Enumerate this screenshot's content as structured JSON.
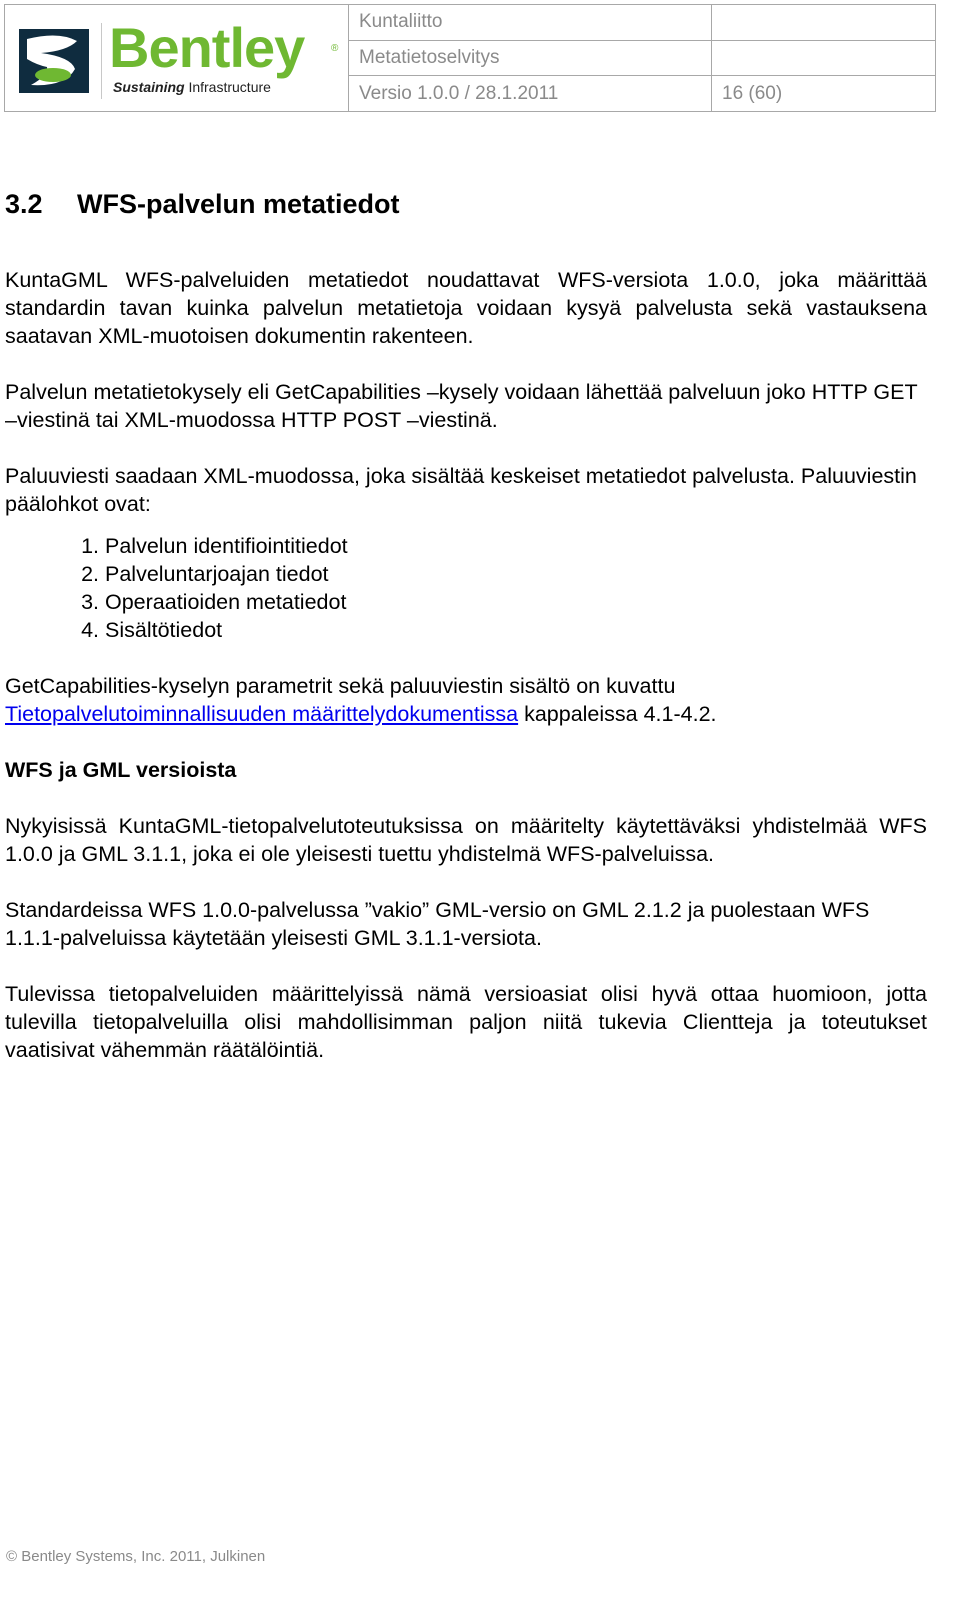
{
  "header": {
    "logo": {
      "brand": "Bentley",
      "tagline_bold": "Sustaining",
      "tagline_rest": "Infrastructure",
      "registered": "®",
      "accent_color": "#6fb832"
    },
    "rows": [
      {
        "main": "Kuntaliitto",
        "side": ""
      },
      {
        "main": "Metatietoselvitys",
        "side": ""
      },
      {
        "main": "Versio 1.0.0 / 28.1.2011",
        "side": "16 (60)"
      }
    ]
  },
  "section": {
    "number": "3.2",
    "title": "WFS-palvelun metatiedot"
  },
  "paragraphs": {
    "p1": "KuntaGML WFS-palveluiden metatiedot noudattavat WFS-versiota 1.0.0, joka määrittää standardin tavan kuinka palvelun metatietoja voidaan kysyä palvelusta sekä vastauksena saatavan XML-muotoisen dokumentin rakenteen.",
    "p2": "Palvelun metatietokysely eli GetCapabilities –kysely voidaan lähettää palveluun joko HTTP GET –viestinä tai XML-muodossa HTTP POST –viestinä.",
    "p3": "Paluuviesti saadaan XML-muodossa, joka sisältää keskeiset metatiedot palvelusta. Paluuviestin päälohkot ovat:",
    "list": [
      "Palvelun identifiointitiedot",
      "Palveluntarjoajan tiedot",
      "Operaatioiden metatiedot",
      "Sisältötiedot"
    ],
    "p4_start": "GetCapabilities-kyselyn parametrit sekä paluuviestin sisältö on kuvattu ",
    "p4_link": "Tietopalvelutoiminnallisuuden määrittelydokumentissa",
    "p4_end": " kappaleissa 4.1-4.2.",
    "subheading": "WFS ja GML versioista",
    "p5": "Nykyisissä KuntaGML-tietopalvelutoteutuksissa on määritelty käytettäväksi yhdistelmää WFS 1.0.0 ja GML 3.1.1, joka ei ole yleisesti tuettu yhdistelmä WFS-palveluissa.",
    "p6": "Standardeissa WFS 1.0.0-palvelussa ”vakio” GML-versio on GML 2.1.2 ja puolestaan WFS 1.1.1-palveluissa käytetään yleisesti GML 3.1.1-versiota.",
    "p7": "Tulevissa tietopalveluiden määrittelyissä nämä versioasiat olisi hyvä ottaa huomioon, jotta tulevilla tietopalveluilla olisi mahdollisimman paljon niitä tukevia Clientteja ja toteutukset vaatisivat vähemmän räätälöintiä."
  },
  "footer": {
    "text": "© Bentley Systems, Inc. 2011, Julkinen"
  }
}
